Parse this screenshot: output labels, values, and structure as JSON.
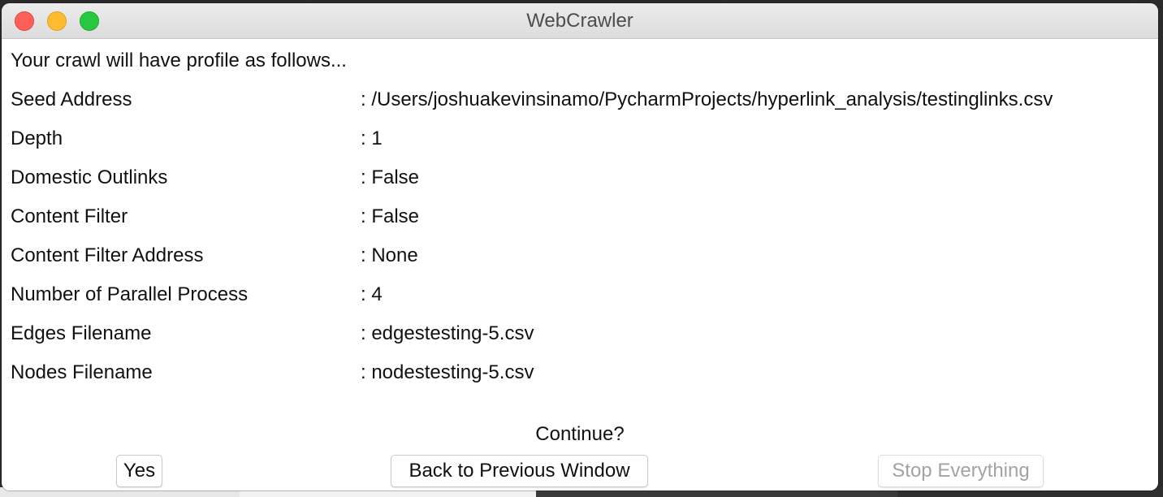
{
  "window": {
    "title": "WebCrawler"
  },
  "dialog": {
    "intro": "Your crawl will have profile as follows...",
    "rows": [
      {
        "label": "Seed Address",
        "value": ": /Users/joshuakevinsinamo/PycharmProjects/hyperlink_analysis/testinglinks.csv"
      },
      {
        "label": "Depth",
        "value": ": 1"
      },
      {
        "label": "Domestic Outlinks",
        "value": ": False"
      },
      {
        "label": "Content Filter",
        "value": ": False"
      },
      {
        "label": "Content Filter Address",
        "value": ": None"
      },
      {
        "label": "Number of Parallel Process",
        "value": ": 4"
      },
      {
        "label": "Edges Filename",
        "value": ": edgestesting-5.csv"
      },
      {
        "label": "Nodes Filename",
        "value": ": nodestesting-5.csv"
      }
    ],
    "prompt": "Continue?",
    "buttons": {
      "yes": "Yes",
      "back": "Back to Previous Window",
      "stop": "Stop Everything"
    }
  },
  "colors": {
    "close": "#fe5f57",
    "minimize": "#febc2e",
    "maximize": "#28c840",
    "disabled_text": "#a3a3a3"
  }
}
